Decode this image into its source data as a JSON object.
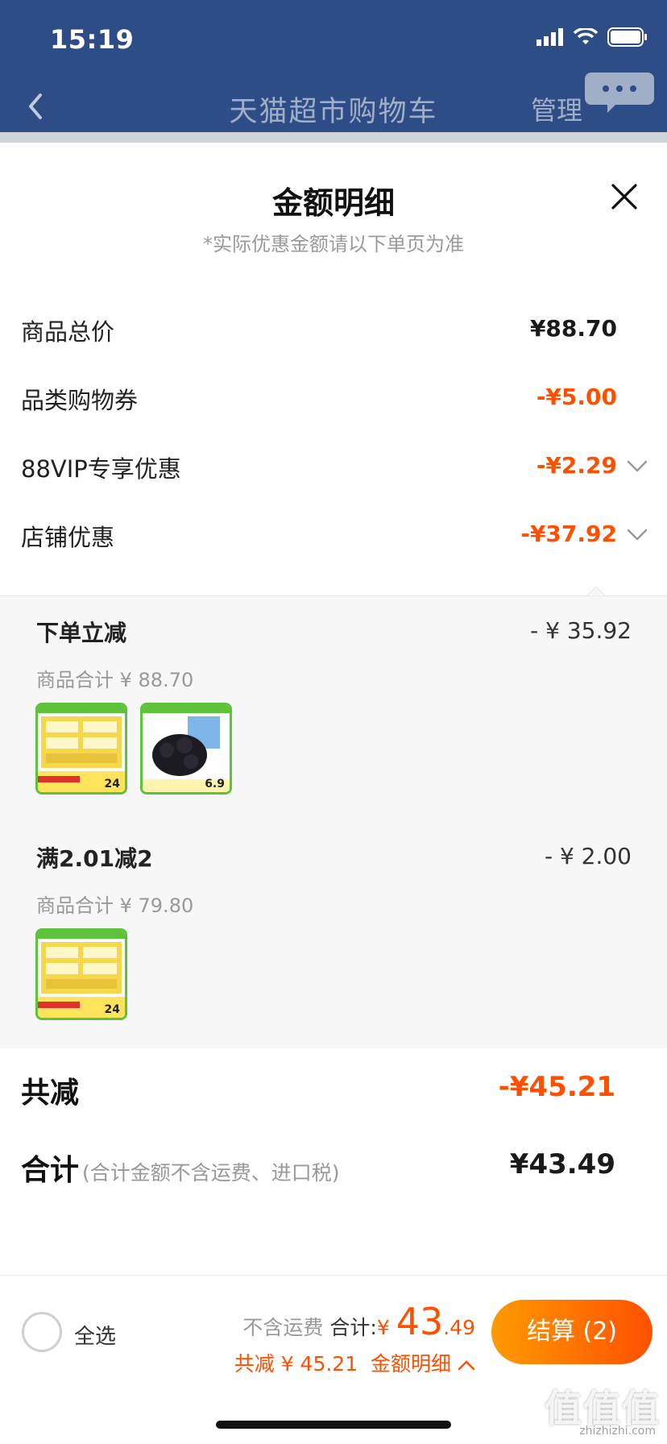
{
  "status": {
    "time": "15:19"
  },
  "nav": {
    "title": "天猫超市购物车",
    "manage": "管理"
  },
  "sheet": {
    "title": "金额明细",
    "subtitle": "*实际优惠金额请以下单页为准",
    "rows": [
      {
        "label": "商品总价",
        "value": "¥88.70"
      },
      {
        "label": "品类购物券",
        "value": "-¥5.00"
      },
      {
        "label": "88VIP专享优惠",
        "value": "-¥2.29"
      },
      {
        "label": "店铺优惠",
        "value": "-¥37.92"
      }
    ],
    "discounts": [
      {
        "title": "下单立减",
        "amount": "- ¥ 35.92",
        "subtotal": "商品合计 ¥ 88.70",
        "thumb_prices": [
          "24",
          "6.9"
        ]
      },
      {
        "title": "满2.01减2",
        "amount": "- ¥ 2.00",
        "subtotal": "商品合计 ¥ 79.80",
        "thumb_prices": [
          "24"
        ]
      }
    ],
    "total_saved_label": "共减",
    "total_saved_value": "-¥45.21",
    "total_label": "合计",
    "total_note": "(合计金额不含运费、进口税)",
    "total_value": "¥43.49"
  },
  "bottom": {
    "select_all": "全选",
    "exclude_shipping": "不含运费",
    "total_prefix": "合计:",
    "currency": "¥",
    "total_int": "43",
    "total_dec": ".49",
    "saved_text": "共减 ¥ 45.21",
    "detail_link": "金额明细",
    "checkout": "结算 (2)"
  },
  "watermark": {
    "text": "值值值",
    "url": "zhizhizhi.com"
  },
  "colors": {
    "nav_bg": "#2e4d86",
    "accent": "#ff5000",
    "panel_bg": "#f7f7f7"
  }
}
